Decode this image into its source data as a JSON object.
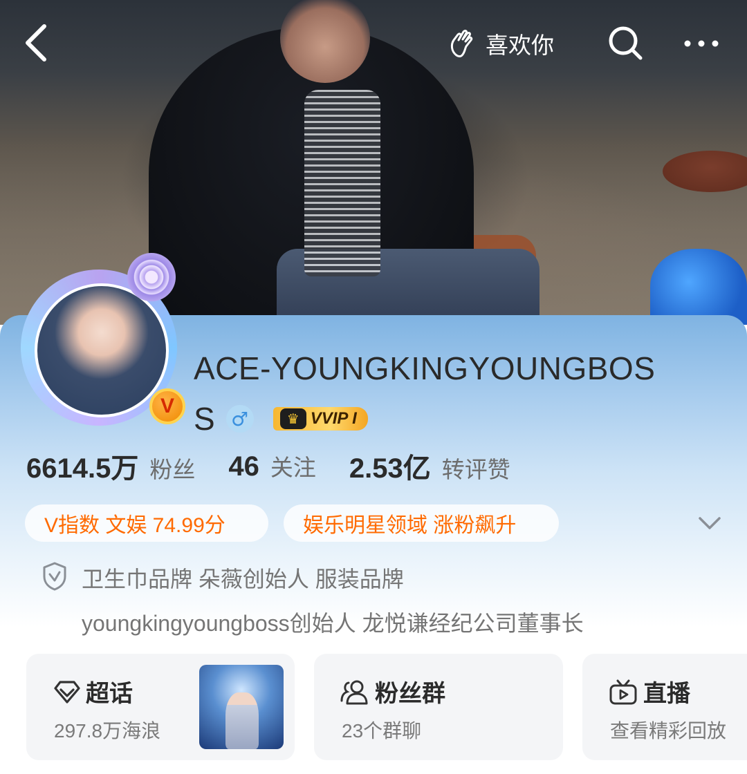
{
  "header": {
    "like_label": "喜欢你"
  },
  "profile": {
    "name_line1": "ACE-YOUNGKINGYOUNGBOS",
    "name_line2": "S",
    "gender_symbol": "♂",
    "vip_label": "VVIP I",
    "avatar_badge": "V"
  },
  "stats": [
    {
      "value": "6614.5万",
      "label": "粉丝"
    },
    {
      "value": "46",
      "label": "关注"
    },
    {
      "value": "2.53亿",
      "label": "转评赞"
    }
  ],
  "chips": {
    "v_index": "V指数 文娱 74.99分",
    "domain": "娱乐明星领域 涨粉飙升"
  },
  "verification": {
    "line1": "卫生巾品牌 朵薇创始人 服装品牌",
    "line2": "youngkingyoungboss创始人 龙悦谦经纪公司董事长"
  },
  "features": [
    {
      "title": "超话",
      "subtitle": "297.8万海浪",
      "icon": "supertopic-icon"
    },
    {
      "title": "粉丝群",
      "subtitle": "23个群聊",
      "icon": "fans-group-icon"
    },
    {
      "title": "直播",
      "subtitle": "查看精彩回放",
      "icon": "tv-icon"
    }
  ],
  "colors": {
    "accent_orange": "#ff6a00",
    "vip_gold": "#f7b731",
    "card_blue": "#7fb3e2"
  }
}
